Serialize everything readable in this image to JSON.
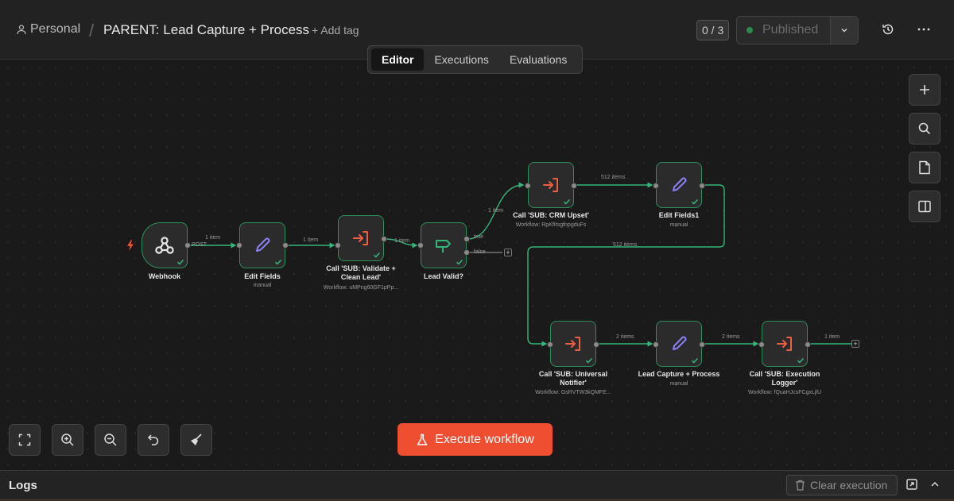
{
  "header": {
    "project": "Personal",
    "separator": "/",
    "workflow_title": "PARENT: Lead Capture + Process",
    "add_tag": "+ Add tag",
    "counter": "0 / 3",
    "publish_label": "Published"
  },
  "tabs": [
    {
      "label": "Editor",
      "active": true
    },
    {
      "label": "Executions",
      "active": false
    },
    {
      "label": "Evaluations",
      "active": false
    }
  ],
  "nodes": [
    {
      "id": "webhook",
      "title": "Webhook",
      "sub": "",
      "icon": "webhook-icon"
    },
    {
      "id": "edit1",
      "title": "Edit Fields",
      "sub": "manual",
      "icon": "pencil-icon"
    },
    {
      "id": "validate",
      "title": "Call 'SUB: Validate + Clean Lead'",
      "sub": "Workflow: uMPng60GF1pPp...",
      "icon": "sub-workflow-icon"
    },
    {
      "id": "if",
      "title": "Lead Valid?",
      "sub": "",
      "icon": "if-icon"
    },
    {
      "id": "crm",
      "title": "Call 'SUB: CRM Upset'",
      "sub": "Workflow: RpKfItsgfnpgduFs",
      "icon": "sub-workflow-icon"
    },
    {
      "id": "edit2",
      "title": "Edit Fields1",
      "sub": "manual",
      "icon": "pencil-icon"
    },
    {
      "id": "notifier",
      "title": "Call 'SUB: Universal Notifier'",
      "sub": "Workflow: GsRVTW3kQMFE...",
      "icon": "sub-workflow-icon"
    },
    {
      "id": "lead",
      "title": "Lead Capture + Process",
      "sub": "manual",
      "icon": "pencil-icon"
    },
    {
      "id": "logger",
      "title": "Call 'SUB: Execution Logger'",
      "sub": "Workflow: fQuaHJcsFCgxLjlU",
      "icon": "sub-workflow-icon"
    }
  ],
  "connections": {
    "post": "POST",
    "l1": "1 item",
    "l2": "1 item",
    "l3": "1 item",
    "l4": "1 item",
    "l5": "512 items",
    "l6": "512 items",
    "l7": "2 items",
    "l8": "2 items",
    "l9": "1 item",
    "true_label": "true",
    "false_label": "false"
  },
  "execute_button": "Execute workflow",
  "logs": {
    "title": "Logs",
    "clear_execution": "Clear execution"
  },
  "colors": {
    "node_border": "#2f8f5b",
    "accent": "#f04e31",
    "sub_workflow_icon": "#ee5e46",
    "edit_icon": "#8b82f7",
    "if_icon": "#35b57a"
  }
}
